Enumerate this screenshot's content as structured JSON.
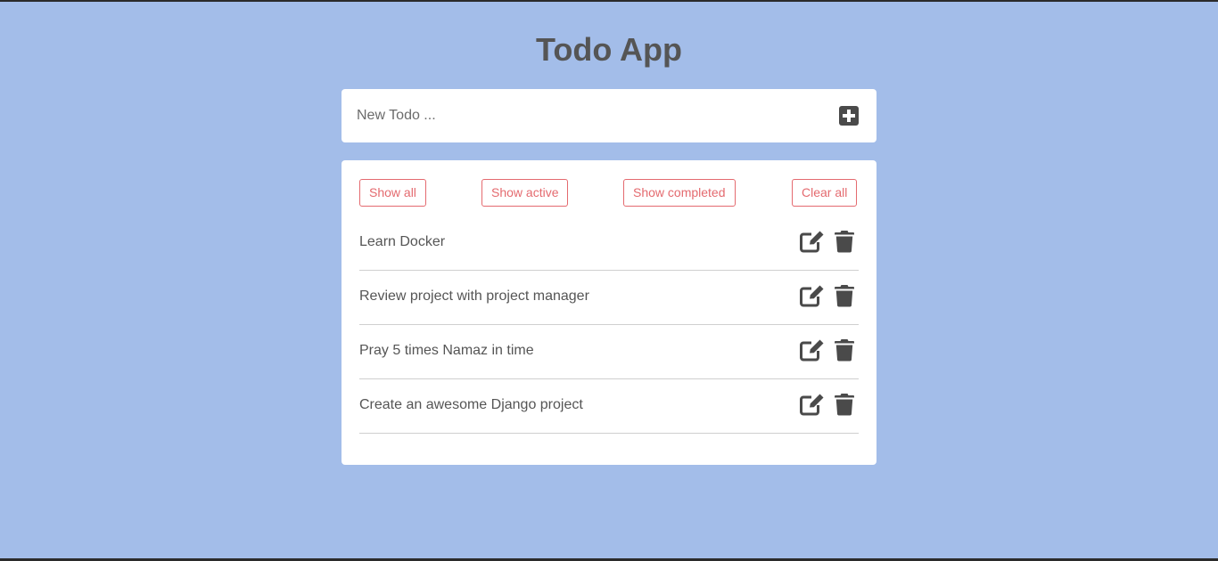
{
  "app": {
    "title": "Todo App"
  },
  "new_todo": {
    "placeholder": "New Todo ...",
    "value": "",
    "add_icon": "plus-square-icon"
  },
  "filters": {
    "show_all": "Show all",
    "show_active": "Show active",
    "show_completed": "Show completed",
    "clear_all": "Clear all"
  },
  "todos": [
    {
      "text": "Learn Docker"
    },
    {
      "text": "Review project with project manager"
    },
    {
      "text": "Pray 5 times Namaz in time"
    },
    {
      "text": "Create an awesome Django project"
    }
  ],
  "icons": {
    "edit": "edit-icon",
    "delete": "trash-icon"
  },
  "colors": {
    "background": "#a3bde9",
    "card": "#ffffff",
    "text": "#555555",
    "accent": "#e46a6f",
    "divider": "#cfcfcf"
  }
}
